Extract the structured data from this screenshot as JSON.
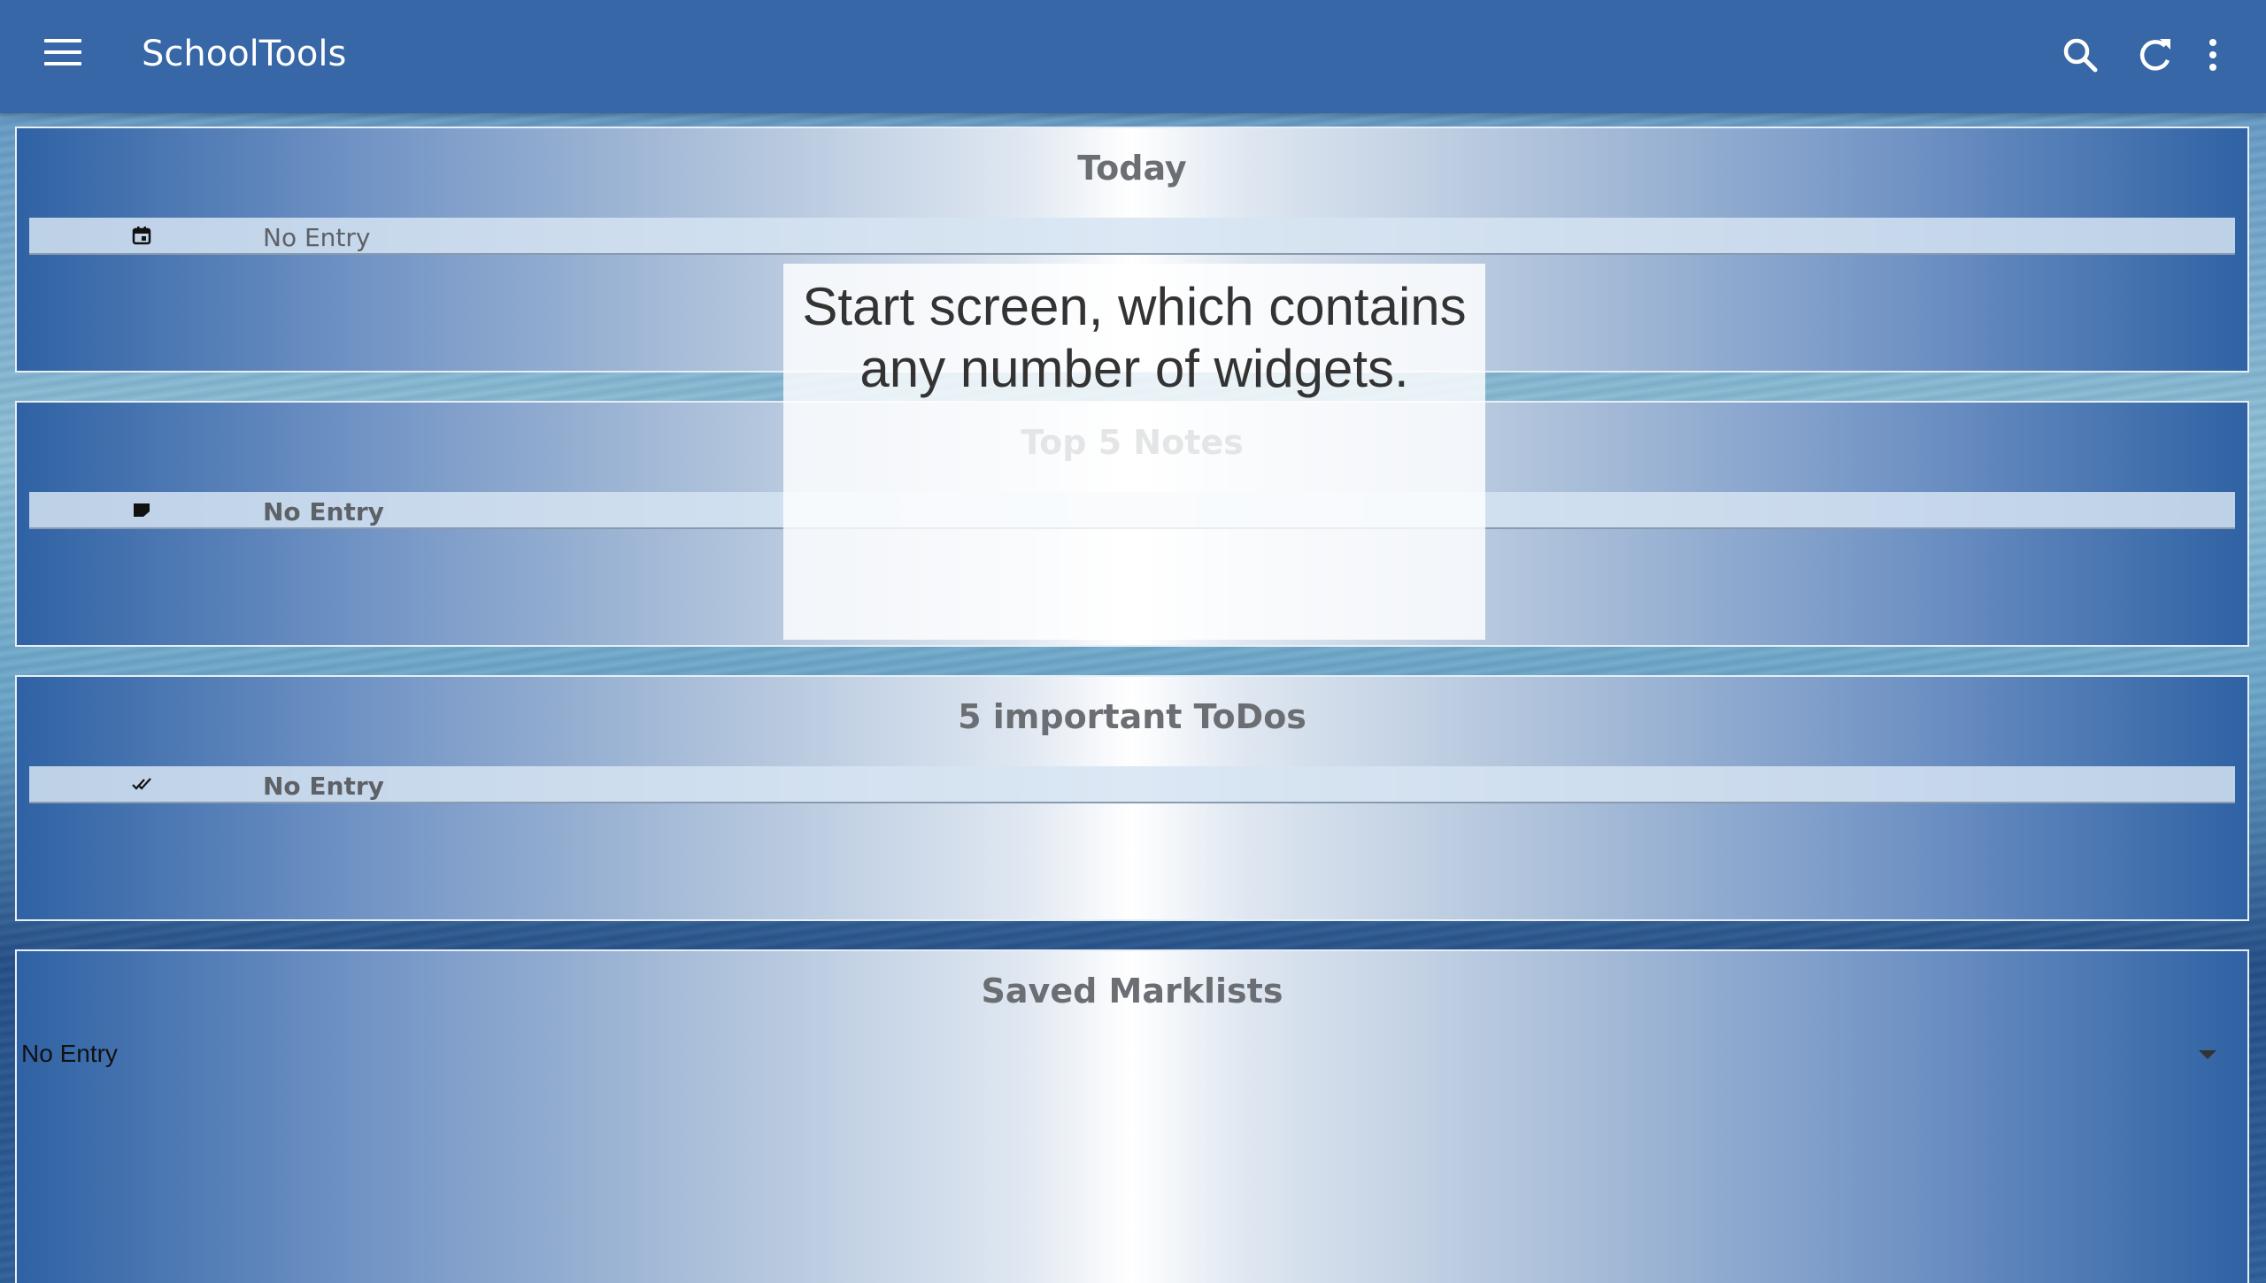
{
  "appbar": {
    "title": "SchoolTools",
    "icons": [
      "menu-icon",
      "search-icon",
      "refresh-icon",
      "more-vert-icon"
    ],
    "background": "#3767a6"
  },
  "widgets": [
    {
      "title": "Today",
      "row_icon": "calendar-icon",
      "row_text": "No Entry"
    },
    {
      "title": "Top 5 Notes",
      "row_icon": "note-icon",
      "row_text": "No Entry"
    },
    {
      "title": "5 important ToDos",
      "row_icon": "double-check-icon",
      "row_text": "No Entry"
    },
    {
      "title": "Saved Marklists",
      "select_value": "No Entry"
    }
  ],
  "overlay": {
    "text": "Start screen, which contains any number of widgets."
  }
}
